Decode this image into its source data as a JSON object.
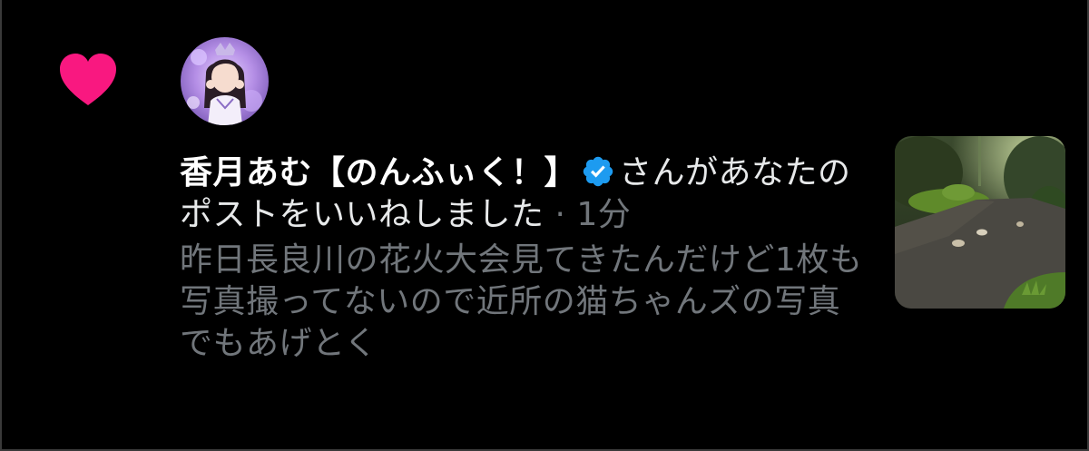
{
  "notification": {
    "type_icon": "heart-icon",
    "accent_color": "#f91880",
    "verified_color": "#1d9bf0",
    "avatar": "user-avatar",
    "display_name": "香月あむ【のんふぃく！】",
    "verified_icon": "verified-badge-icon",
    "action_text": "さんがあなたのポストをいいねしました",
    "separator": "·",
    "timestamp": "1分",
    "post_preview": "昨日長良川の花火大会見てきたんだけど1枚も写真撮ってないので近所の猫ちゃんズの写真でもあげとく",
    "thumbnail": "post-thumbnail-image"
  }
}
